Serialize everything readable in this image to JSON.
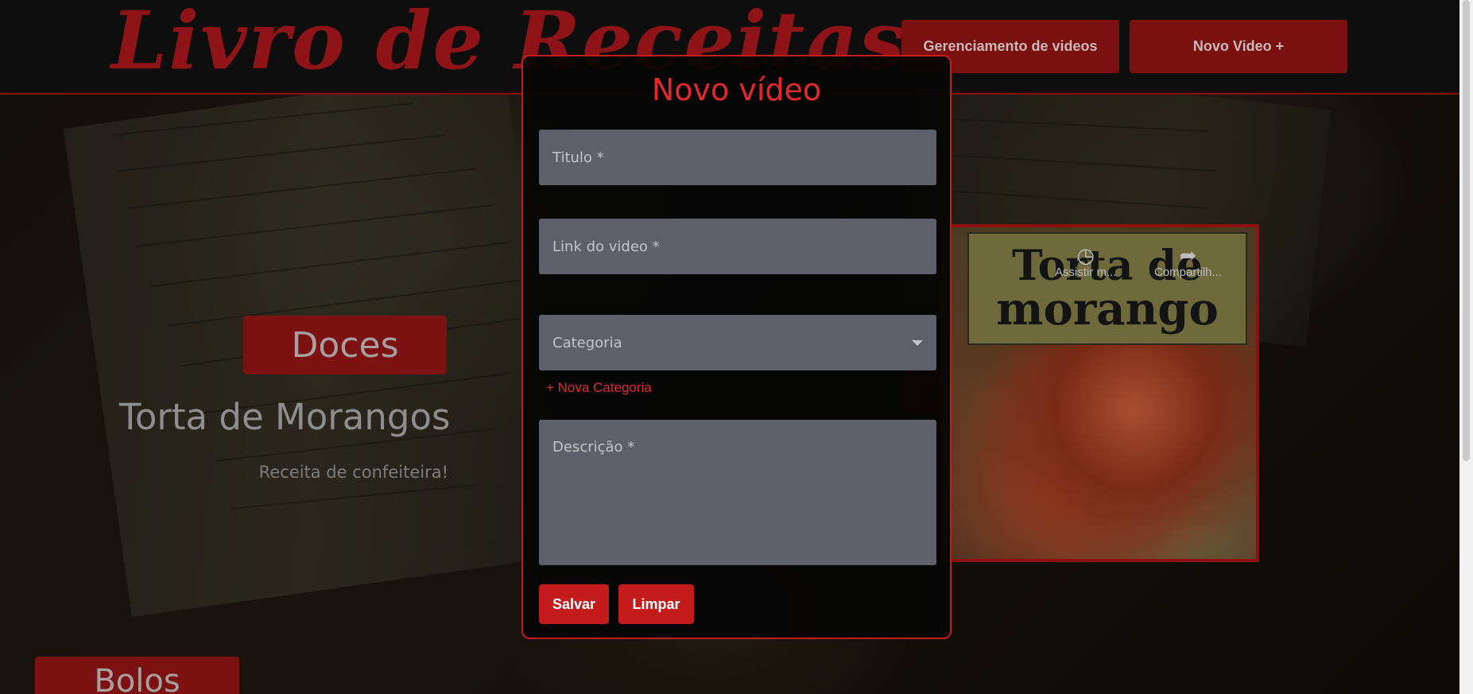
{
  "header": {
    "logo_text": "Livro de Receitas",
    "nav": {
      "manage_label": "Gerenciamento de videos",
      "new_label": "Novo Video +"
    }
  },
  "banner": {
    "category": "Doces",
    "title": "Torta de Morangos",
    "description": "Receita de confeiteira!",
    "video": {
      "label_line1": "Torta de",
      "label_line2": "morango",
      "watch_label": "Assistir m...",
      "share_label": "Compartilh..."
    }
  },
  "next_section": {
    "category": "Bolos"
  },
  "modal": {
    "title": "Novo vídeo",
    "fields": {
      "titulo_placeholder": "Titulo *",
      "link_placeholder": "Link do video *",
      "categoria_placeholder": "Categoria",
      "descricao_placeholder": "Descrição *"
    },
    "nova_categoria": "+ Nova Categoria",
    "save_label": "Salvar",
    "clear_label": "Limpar"
  },
  "colors": {
    "accent": "#c41c1c",
    "title_red": "#e2292b",
    "header_bg": "#0e0e0e",
    "field_bg": "#5d6069"
  },
  "icons": {
    "watch_later": "clock-icon",
    "share": "share-arrow-icon",
    "play": "youtube-play-icon",
    "select_caret": "caret-down-icon"
  }
}
